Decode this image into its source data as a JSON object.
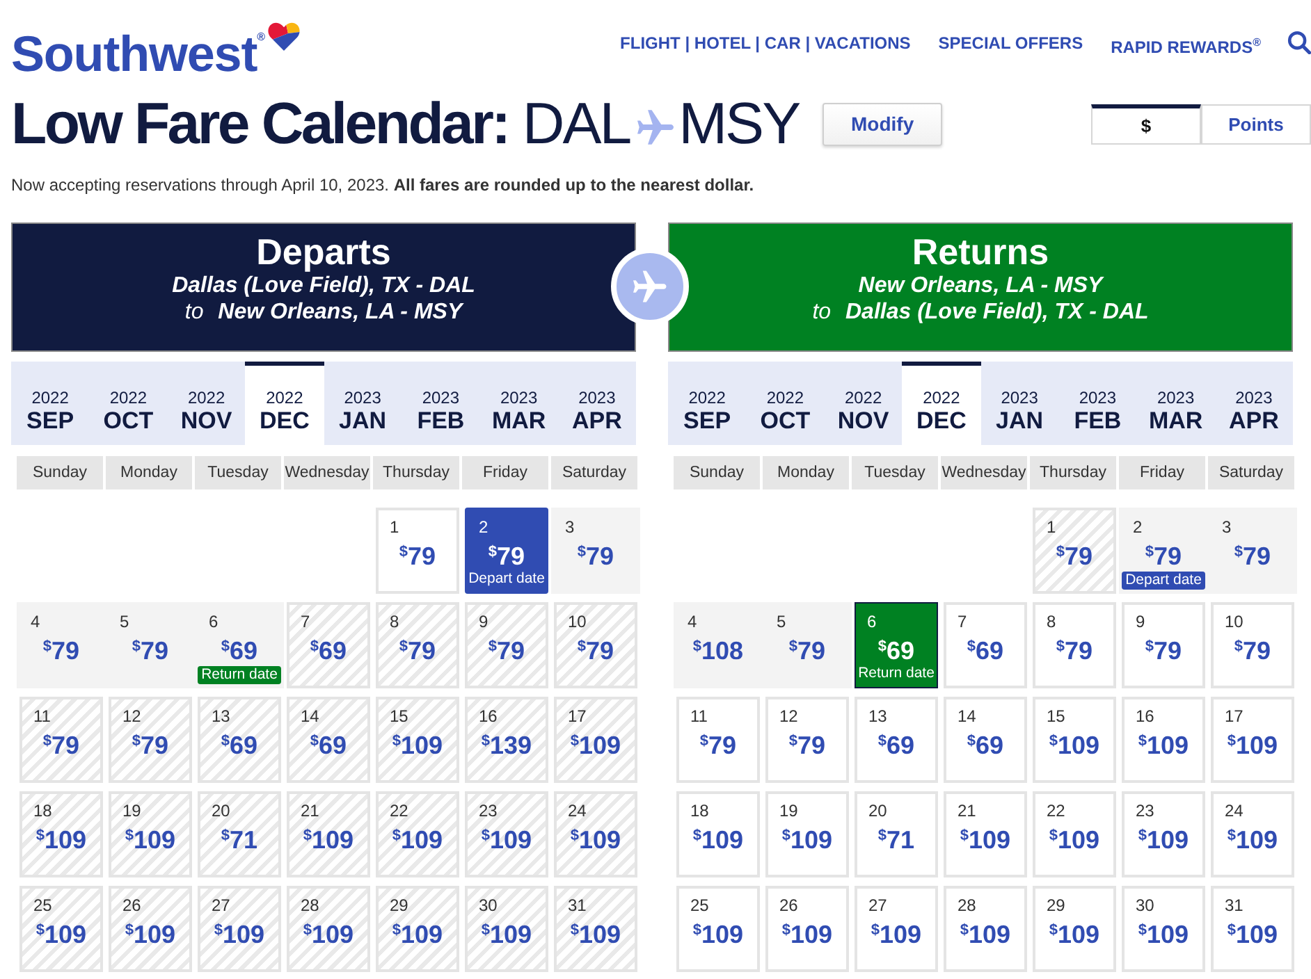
{
  "header": {
    "logo": "Southwest$^{®}$",
    "nav": [
      {
        "label": "FLIGHT | HOTEL | CAR | VACATIONS"
      },
      {
        "label": "SPECIAL OFFERS"
      },
      {
        "label": "RAPID REWARDS$^{®}$"
      }
    ]
  },
  "title": {
    "label": "Low Fare Calendar:",
    "origin": "DAL",
    "destination": "MSY",
    "modify_button": "Modify"
  },
  "fare_toggle": [
    {
      "label": "$",
      "selected": true
    },
    {
      "label": "Points",
      "selected": false
    }
  ],
  "notice": "Now accepting reservations through April 10, 2023. **All fares are rounded up to the nearest dollar.**",
  "calendars": [
    {
      "title": "Departs",
      "color": "#111b40",
      "route_from": "Dallas (Love Field), TX - DAL",
      "route_to": "to **New Orleans, LA - MSY**",
      "months": [
        {
          "year": "2022",
          "month": "SEP",
          "selected": false
        },
        {
          "year": "2022",
          "month": "OCT",
          "selected": false
        },
        {
          "year": "2022",
          "month": "NOV",
          "selected": false
        },
        {
          "year": "2022",
          "month": "DEC",
          "selected": true
        },
        {
          "year": "2023",
          "month": "JAN",
          "selected": false
        },
        {
          "year": "2023",
          "month": "FEB",
          "selected": false
        },
        {
          "year": "2023",
          "month": "MAR",
          "selected": false
        },
        {
          "year": "2023",
          "month": "APR",
          "selected": false
        }
      ],
      "weekdays": [
        "Sunday",
        "Monday",
        "Tuesday",
        "Wednesday",
        "Thursday",
        "Friday",
        "Saturday"
      ],
      "weeks": [
        [
          {
            "day": "1",
            "price": "$^{$}$79",
            "kind": "open",
            "selected": false
          },
          {
            "day": "2",
            "price": "$^{$}$79",
            "kind": "range",
            "selected": true,
            "note": {
              "text": "Depart date",
              "color": "#304cb2"
            }
          },
          {
            "day": "3",
            "price": "$^{$}$79",
            "kind": "range",
            "selected": false
          }
        ],
        [
          {
            "day": "4",
            "price": "$^{$}$79",
            "kind": "range",
            "selected": false
          },
          {
            "day": "5",
            "price": "$^{$}$79",
            "kind": "range",
            "selected": false
          },
          {
            "day": "6",
            "price": "$^{$}$69",
            "kind": "range",
            "selected": false,
            "note": {
              "text": "Return date",
              "color": "#008122"
            }
          },
          {
            "day": "7",
            "price": "$^{$}$69",
            "kind": "striped",
            "selected": false
          },
          {
            "day": "8",
            "price": "$^{$}$79",
            "kind": "striped",
            "selected": false
          },
          {
            "day": "9",
            "price": "$^{$}$79",
            "kind": "striped",
            "selected": false
          },
          {
            "day": "10",
            "price": "$^{$}$79",
            "kind": "striped",
            "selected": false
          }
        ],
        [
          {
            "day": "11",
            "price": "$^{$}$79",
            "kind": "striped",
            "selected": false
          },
          {
            "day": "12",
            "price": "$^{$}$79",
            "kind": "striped",
            "selected": false
          },
          {
            "day": "13",
            "price": "$^{$}$69",
            "kind": "striped",
            "selected": false
          },
          {
            "day": "14",
            "price": "$^{$}$69",
            "kind": "striped",
            "selected": false
          },
          {
            "day": "15",
            "price": "$^{$}$109",
            "kind": "striped",
            "selected": false
          },
          {
            "day": "16",
            "price": "$^{$}$139",
            "kind": "striped",
            "selected": false
          },
          {
            "day": "17",
            "price": "$^{$}$109",
            "kind": "striped",
            "selected": false
          }
        ],
        [
          {
            "day": "18",
            "price": "$^{$}$109",
            "kind": "striped",
            "selected": false
          },
          {
            "day": "19",
            "price": "$^{$}$109",
            "kind": "striped",
            "selected": false
          },
          {
            "day": "20",
            "price": "$^{$}$71",
            "kind": "striped",
            "selected": false
          },
          {
            "day": "21",
            "price": "$^{$}$109",
            "kind": "striped",
            "selected": false
          },
          {
            "day": "22",
            "price": "$^{$}$109",
            "kind": "striped",
            "selected": false
          },
          {
            "day": "23",
            "price": "$^{$}$109",
            "kind": "striped",
            "selected": false
          },
          {
            "day": "24",
            "price": "$^{$}$109",
            "kind": "striped",
            "selected": false
          }
        ],
        [
          {
            "day": "25",
            "price": "$^{$}$109",
            "kind": "striped",
            "selected": false
          },
          {
            "day": "26",
            "price": "$^{$}$109",
            "kind": "striped",
            "selected": false
          },
          {
            "day": "27",
            "price": "$^{$}$109",
            "kind": "striped",
            "selected": false
          },
          {
            "day": "28",
            "price": "$^{$}$109",
            "kind": "striped",
            "selected": false
          },
          {
            "day": "29",
            "price": "$^{$}$109",
            "kind": "striped",
            "selected": false
          },
          {
            "day": "30",
            "price": "$^{$}$109",
            "kind": "striped",
            "selected": false
          },
          {
            "day": "31",
            "price": "$^{$}$109",
            "kind": "striped",
            "selected": false
          }
        ]
      ]
    },
    {
      "title": "Returns",
      "color": "#008122",
      "route_from": "New Orleans, LA - MSY",
      "route_to": "to **Dallas (Love Field), TX - DAL**",
      "months": [
        {
          "year": "2022",
          "month": "SEP",
          "selected": false
        },
        {
          "year": "2022",
          "month": "OCT",
          "selected": false
        },
        {
          "year": "2022",
          "month": "NOV",
          "selected": false
        },
        {
          "year": "2022",
          "month": "DEC",
          "selected": true
        },
        {
          "year": "2023",
          "month": "JAN",
          "selected": false
        },
        {
          "year": "2023",
          "month": "FEB",
          "selected": false
        },
        {
          "year": "2023",
          "month": "MAR",
          "selected": false
        },
        {
          "year": "2023",
          "month": "APR",
          "selected": false
        }
      ],
      "weekdays": [
        "Sunday",
        "Monday",
        "Tuesday",
        "Wednesday",
        "Thursday",
        "Friday",
        "Saturday"
      ],
      "weeks": [
        [
          {
            "day": "1",
            "price": "$^{$}$79",
            "kind": "striped",
            "selected": false
          },
          {
            "day": "2",
            "price": "$^{$}$79",
            "kind": "range",
            "selected": false,
            "note": {
              "text": "Depart date",
              "color": "#304cb2"
            }
          },
          {
            "day": "3",
            "price": "$^{$}$79",
            "kind": "range",
            "selected": false
          }
        ],
        [
          {
            "day": "4",
            "price": "$^{$}$108",
            "kind": "range",
            "selected": false
          },
          {
            "day": "5",
            "price": "$^{$}$79",
            "kind": "range",
            "selected": false
          },
          {
            "day": "6",
            "price": "$^{$}$69",
            "kind": "open",
            "selected": true,
            "note": {
              "text": "Return date",
              "color": "#008122"
            }
          },
          {
            "day": "7",
            "price": "$^{$}$69",
            "kind": "open",
            "selected": false
          },
          {
            "day": "8",
            "price": "$^{$}$79",
            "kind": "open",
            "selected": false
          },
          {
            "day": "9",
            "price": "$^{$}$79",
            "kind": "open",
            "selected": false
          },
          {
            "day": "10",
            "price": "$^{$}$79",
            "kind": "open",
            "selected": false
          }
        ],
        [
          {
            "day": "11",
            "price": "$^{$}$79",
            "kind": "open",
            "selected": false
          },
          {
            "day": "12",
            "price": "$^{$}$79",
            "kind": "open",
            "selected": false
          },
          {
            "day": "13",
            "price": "$^{$}$69",
            "kind": "open",
            "selected": false
          },
          {
            "day": "14",
            "price": "$^{$}$69",
            "kind": "open",
            "selected": false
          },
          {
            "day": "15",
            "price": "$^{$}$109",
            "kind": "open",
            "selected": false
          },
          {
            "day": "16",
            "price": "$^{$}$109",
            "kind": "open",
            "selected": false
          },
          {
            "day": "17",
            "price": "$^{$}$109",
            "kind": "open",
            "selected": false
          }
        ],
        [
          {
            "day": "18",
            "price": "$^{$}$109",
            "kind": "open",
            "selected": false
          },
          {
            "day": "19",
            "price": "$^{$}$109",
            "kind": "open",
            "selected": false
          },
          {
            "day": "20",
            "price": "$^{$}$71",
            "kind": "open",
            "selected": false
          },
          {
            "day": "21",
            "price": "$^{$}$109",
            "kind": "open",
            "selected": false
          },
          {
            "day": "22",
            "price": "$^{$}$109",
            "kind": "open",
            "selected": false
          },
          {
            "day": "23",
            "price": "$^{$}$109",
            "kind": "open",
            "selected": false
          },
          {
            "day": "24",
            "price": "$^{$}$109",
            "kind": "open",
            "selected": false
          }
        ],
        [
          {
            "day": "25",
            "price": "$^{$}$109",
            "kind": "open",
            "selected": false
          },
          {
            "day": "26",
            "price": "$^{$}$109",
            "kind": "open",
            "selected": false
          },
          {
            "day": "27",
            "price": "$^{$}$109",
            "kind": "open",
            "selected": false
          },
          {
            "day": "28",
            "price": "$^{$}$109",
            "kind": "open",
            "selected": false
          },
          {
            "day": "29",
            "price": "$^{$}$109",
            "kind": "open",
            "selected": false
          },
          {
            "day": "30",
            "price": "$^{$}$109",
            "kind": "open",
            "selected": false
          },
          {
            "day": "31",
            "price": "$^{$}$109",
            "kind": "open",
            "selected": false
          }
        ]
      ]
    }
  ]
}
